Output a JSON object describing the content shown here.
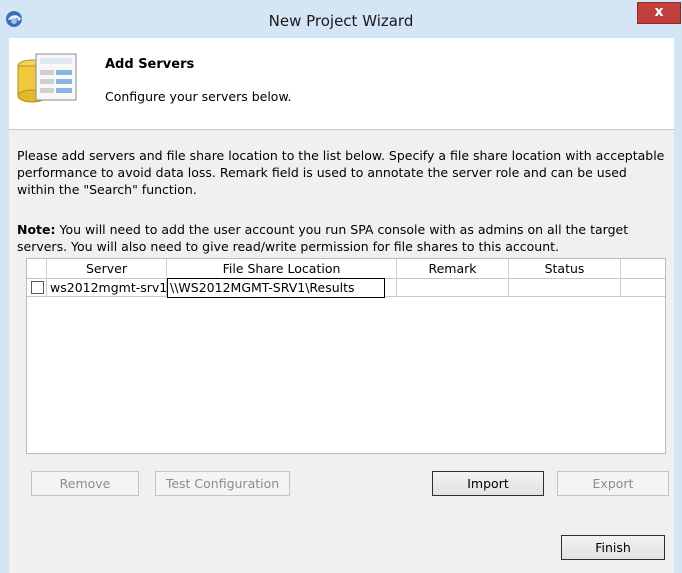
{
  "window": {
    "title": "New Project Wizard",
    "close_label": "x"
  },
  "header": {
    "title": "Add Servers",
    "subtitle": "Configure your servers below."
  },
  "description": "Please add servers and file share location to the list below. Specify a file share location with acceptable performance to avoid data loss. Remark field is used to annotate the server role and can be used within the \"Search\" function.",
  "note": {
    "label": "Note:",
    "text": " You will need to add the user account you run SPA console with as admins on all the target servers. You will also need to give read/write permission for file shares to this account."
  },
  "grid": {
    "columns": [
      "Server",
      "File Share Location",
      "Remark",
      "Status"
    ],
    "rows": [
      {
        "checked": false,
        "server": "ws2012mgmt-srv1",
        "file_share": "\\\\WS2012MGMT-SRV1\\Results",
        "remark": "",
        "status": ""
      }
    ]
  },
  "buttons": {
    "remove": "Remove",
    "test_configuration": "Test Configuration",
    "import": "Import",
    "export": "Export",
    "finish": "Finish"
  }
}
